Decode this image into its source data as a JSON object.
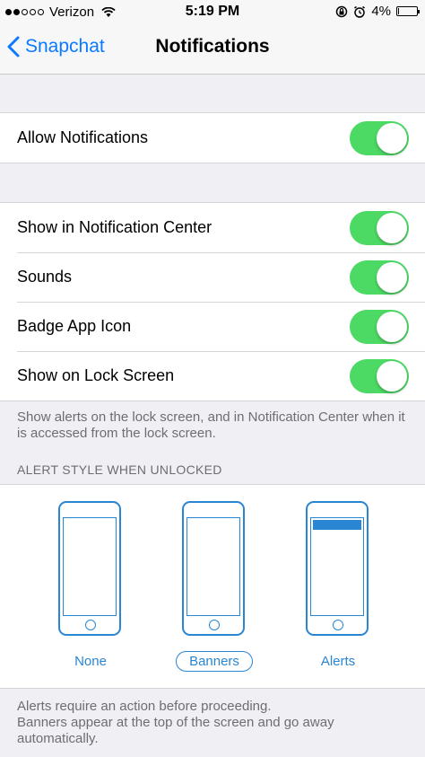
{
  "status_bar": {
    "carrier": "Verizon",
    "signal_dots_filled": 2,
    "signal_dots_total": 5,
    "time": "5:19 PM",
    "battery_percent": "4%",
    "battery_level": 0.04
  },
  "nav": {
    "back_label": "Snapchat",
    "title": "Notifications",
    "accent": "#0a7aff"
  },
  "allow": {
    "label": "Allow Notifications",
    "on": true
  },
  "settings": [
    {
      "label": "Show in Notification Center",
      "on": true
    },
    {
      "label": "Sounds",
      "on": true
    },
    {
      "label": "Badge App Icon",
      "on": true
    },
    {
      "label": "Show on Lock Screen",
      "on": true
    }
  ],
  "lock_screen_note": "Show alerts on the lock screen, and in Notification Center when it is accessed from the lock screen.",
  "alert_section_header": "ALERT STYLE WHEN UNLOCKED",
  "alert_styles": [
    {
      "label": "None",
      "selected": false
    },
    {
      "label": "Banners",
      "selected": true
    },
    {
      "label": "Alerts",
      "selected": false
    }
  ],
  "alert_footer": [
    "Alerts require an action before proceeding.",
    "Banners appear at the top of the screen and go away automatically."
  ],
  "colors": {
    "toggle_on": "#4cd964",
    "style_blue": "#2a85d3"
  }
}
